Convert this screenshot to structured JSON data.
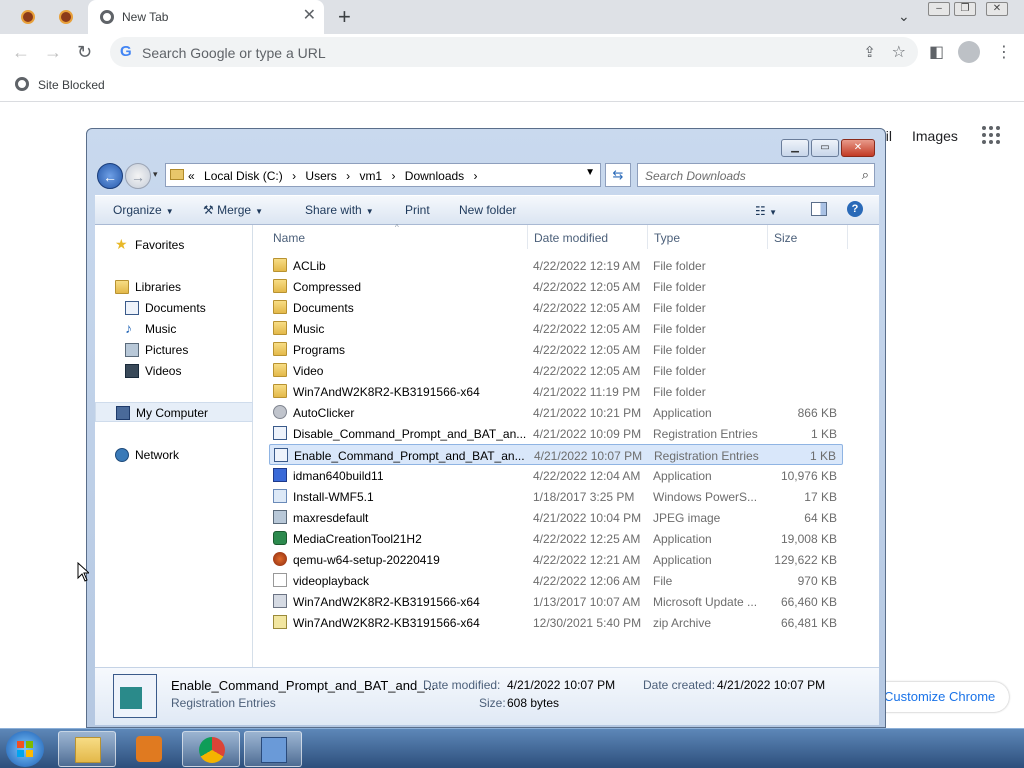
{
  "browser": {
    "tab_title": "New Tab",
    "omnibox_placeholder": "Search Google or type a URL",
    "bookmark_label": "Site Blocked",
    "page_links": {
      "mail": "ail",
      "images": "Images"
    },
    "customize_label": "Customize Chrome"
  },
  "explorer": {
    "breadcrumb": [
      "«",
      "Local Disk (C:)",
      "›",
      "Users",
      "›",
      "vm1",
      "›",
      "Downloads",
      "›"
    ],
    "search_placeholder": "Search Downloads",
    "commands": {
      "organize": "Organize",
      "merge": "Merge",
      "share_with": "Share with",
      "print": "Print",
      "new_folder": "New folder"
    },
    "nav": {
      "favorites": "Favorites",
      "libraries": "Libraries",
      "documents": "Documents",
      "music": "Music",
      "pictures": "Pictures",
      "videos": "Videos",
      "my_computer": "My Computer",
      "network": "Network"
    },
    "columns": {
      "name": "Name",
      "date": "Date modified",
      "type": "Type",
      "size": "Size"
    },
    "files": [
      {
        "name": "ACLib",
        "date": "4/22/2022 12:19 AM",
        "type": "File folder",
        "size": "",
        "icon": "folder"
      },
      {
        "name": "Compressed",
        "date": "4/22/2022 12:05 AM",
        "type": "File folder",
        "size": "",
        "icon": "folder"
      },
      {
        "name": "Documents",
        "date": "4/22/2022 12:05 AM",
        "type": "File folder",
        "size": "",
        "icon": "folder"
      },
      {
        "name": "Music",
        "date": "4/22/2022 12:05 AM",
        "type": "File folder",
        "size": "",
        "icon": "folder"
      },
      {
        "name": "Programs",
        "date": "4/22/2022 12:05 AM",
        "type": "File folder",
        "size": "",
        "icon": "folder"
      },
      {
        "name": "Video",
        "date": "4/22/2022 12:05 AM",
        "type": "File folder",
        "size": "",
        "icon": "folder"
      },
      {
        "name": "Win7AndW2K8R2-KB3191566-x64",
        "date": "4/21/2022 11:19 PM",
        "type": "File folder",
        "size": "",
        "icon": "folder"
      },
      {
        "name": "AutoClicker",
        "date": "4/21/2022 10:21 PM",
        "type": "Application",
        "size": "866 KB",
        "icon": "app"
      },
      {
        "name": "Disable_Command_Prompt_and_BAT_an...",
        "date": "4/21/2022 10:09 PM",
        "type": "Registration Entries",
        "size": "1 KB",
        "icon": "reg"
      },
      {
        "name": "Enable_Command_Prompt_and_BAT_an...",
        "date": "4/21/2022 10:07 PM",
        "type": "Registration Entries",
        "size": "1 KB",
        "icon": "reg",
        "selected": true
      },
      {
        "name": "idman640build11",
        "date": "4/22/2022 12:04 AM",
        "type": "Application",
        "size": "10,976 KB",
        "icon": "installer"
      },
      {
        "name": "Install-WMF5.1",
        "date": "1/18/2017 3:25 PM",
        "type": "Windows PowerS...",
        "size": "17 KB",
        "icon": "ps"
      },
      {
        "name": "maxresdefault",
        "date": "4/21/2022 10:04 PM",
        "type": "JPEG image",
        "size": "64 KB",
        "icon": "img"
      },
      {
        "name": "MediaCreationTool21H2",
        "date": "4/22/2022 12:25 AM",
        "type": "Application",
        "size": "19,008 KB",
        "icon": "media"
      },
      {
        "name": "qemu-w64-setup-20220419",
        "date": "4/22/2022 12:21 AM",
        "type": "Application",
        "size": "129,622 KB",
        "icon": "qemu"
      },
      {
        "name": "videoplayback",
        "date": "4/22/2022 12:06 AM",
        "type": "File",
        "size": "970 KB",
        "icon": "file"
      },
      {
        "name": "Win7AndW2K8R2-KB3191566-x64",
        "date": "1/13/2017 10:07 AM",
        "type": "Microsoft Update ...",
        "size": "66,460 KB",
        "icon": "msu"
      },
      {
        "name": "Win7AndW2K8R2-KB3191566-x64",
        "date": "12/30/2021 5:40 PM",
        "type": "zip Archive",
        "size": "66,481 KB",
        "icon": "zip"
      }
    ],
    "details": {
      "filename": "Enable_Command_Prompt_and_BAT_and_...",
      "filetype": "Registration Entries",
      "modified_label": "Date modified:",
      "modified_value": "4/21/2022 10:07 PM",
      "created_label": "Date created:",
      "created_value": "4/21/2022 10:07 PM",
      "size_label": "Size:",
      "size_value": "608 bytes"
    }
  }
}
